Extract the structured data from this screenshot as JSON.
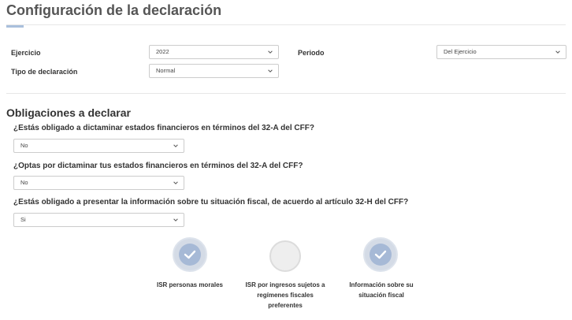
{
  "page": {
    "title": "Configuración de la declaración"
  },
  "form": {
    "ejercicio": {
      "label": "Ejercicio",
      "value": "2022"
    },
    "periodo": {
      "label": "Periodo",
      "value": "Del Ejercicio"
    },
    "tipo": {
      "label": "Tipo de declaración",
      "value": "Normal"
    }
  },
  "obligaciones": {
    "title": "Obligaciones a declarar",
    "questions": [
      {
        "text": "¿Estás obligado a dictaminar estados financieros en términos del 32-A del CFF?",
        "value": "No"
      },
      {
        "text": "¿Optas por dictaminar tus estados financieros en términos del 32-A del CFF?",
        "value": "No"
      },
      {
        "text": "¿Estás obligado a presentar la información sobre tu situación fiscal, de acuerdo al artículo 32-H del CFF?",
        "value": "Si"
      }
    ],
    "options": [
      {
        "label": "ISR personas morales",
        "checked": true
      },
      {
        "label": "ISR por ingresos sujetos a regímenes fiscales preferentes",
        "checked": false
      },
      {
        "label": "Información sobre su situación fiscal",
        "checked": true
      }
    ]
  },
  "colors": {
    "accent": "#a9bfdc",
    "check_fill": "#a6b9d6",
    "empty_fill": "#eeeeee"
  },
  "icons": {
    "dropdown": "chevron-down-icon",
    "check": "check-icon"
  }
}
